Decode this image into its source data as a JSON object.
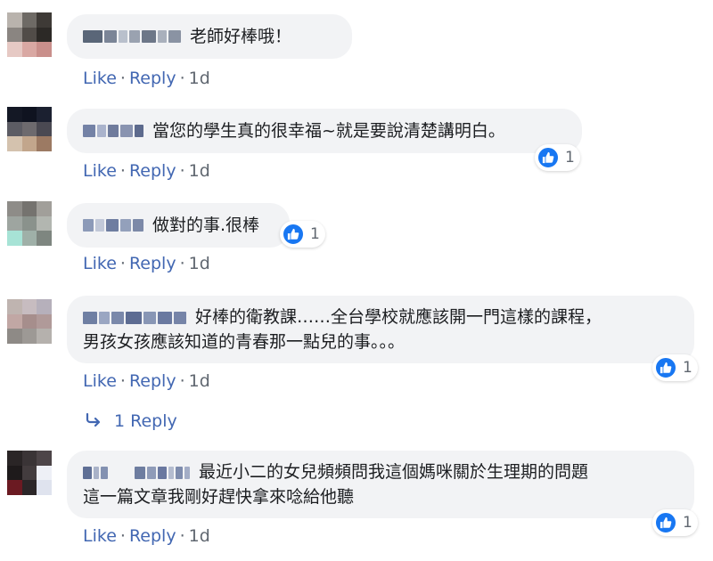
{
  "comments": [
    {
      "text": "老師好棒哦！",
      "action_like": "Like",
      "action_reply": "Reply",
      "time": "1d",
      "reactions": ""
    },
    {
      "text": "當您的學生真的很幸福~就是要說清楚講明白。",
      "action_like": "Like",
      "action_reply": "Reply",
      "time": "1d",
      "reactions": "1"
    },
    {
      "text": "做對的事.很棒",
      "action_like": "Like",
      "action_reply": "Reply",
      "time": "1d",
      "reactions": "1"
    },
    {
      "text_line1": "好棒的衛教課……全台學校就應該開一門這樣的課程，",
      "text_line2": "男孩女孩應該知道的青春那一點兒的事。。。",
      "action_like": "Like",
      "action_reply": "Reply",
      "time": "1d",
      "reactions": "1",
      "replies_label": "1 Reply"
    },
    {
      "text_line1": "最近小二的女兒頻頻問我這個媽咪關於生理期的問題",
      "text_line2": "這一篇文章我剛好趕快拿來唸給他聽",
      "action_like": "Like",
      "action_reply": "Reply",
      "time": "1d",
      "reactions": "1"
    }
  ],
  "icons": {
    "like": "thumbs-up-icon",
    "reply_arrow": "reply-arrow-icon"
  },
  "colors": {
    "link": "#4267b2",
    "bubble": "#f2f3f5",
    "like_blue": "#1877f2",
    "meta": "#606770"
  }
}
